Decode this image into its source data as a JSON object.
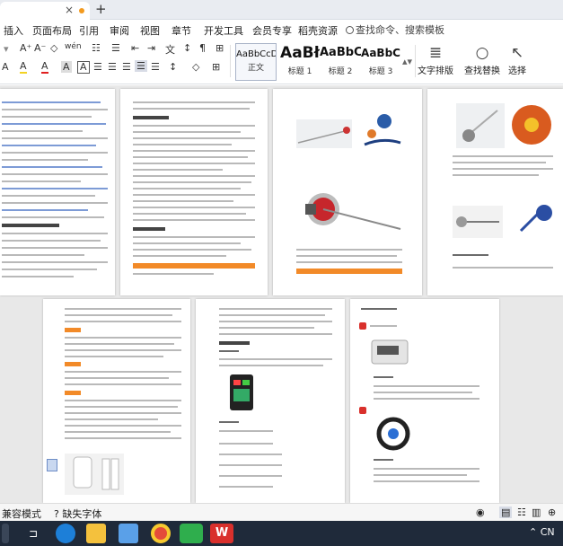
{
  "tabbar": {
    "close_glyph": "×",
    "new_tab_glyph": "+"
  },
  "menu": {
    "items": [
      "插入",
      "页面布局",
      "引用",
      "审阅",
      "视图",
      "章节",
      "开发工具",
      "会员专享",
      "稻壳资源"
    ],
    "search_placeholder": "查找命令、搜索模板"
  },
  "toolbar": {
    "font_grow": "A⁺",
    "font_shrink": "A⁻",
    "clear_format": "◇",
    "pinyin": "wén",
    "highlight": "A",
    "font_color": "A",
    "char_shade": "A",
    "char_border": "A",
    "styles": [
      {
        "sample": "AaBbCcDd",
        "label": "正文"
      },
      {
        "sample": "AaBł",
        "label": "标题 1"
      },
      {
        "sample": "AaBbC",
        "label": "标题 2"
      },
      {
        "sample": "AaBbC",
        "label": "标题 3"
      }
    ],
    "text_layout": "文字排版",
    "find_replace": "查找替换",
    "select": "选择"
  },
  "statusbar": {
    "compat_mode": "兼容模式",
    "missing_fonts": "缺失字体"
  },
  "tray": {
    "ime": "CN"
  },
  "colors": {
    "accent_orange": "#f28a28",
    "wps_red": "#d9302c",
    "taskbar": "#1f2a3a"
  }
}
